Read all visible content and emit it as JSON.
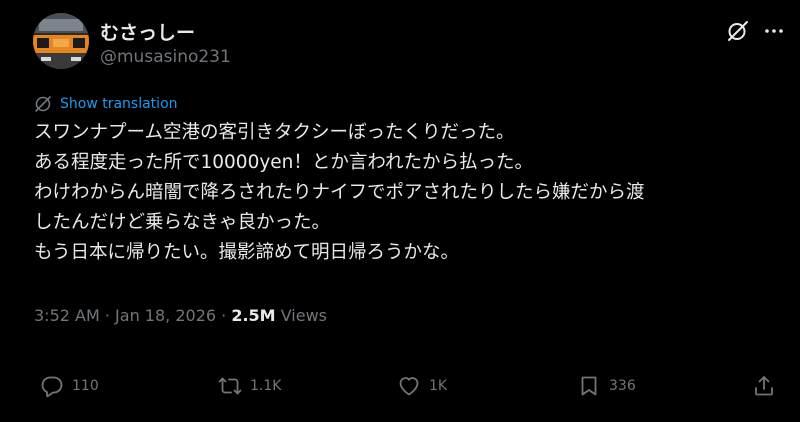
{
  "author": {
    "display_name": "むさっしー",
    "handle": "@musasino231",
    "avatar_icon": "train-avatar"
  },
  "header_icons": [
    "grok-icon",
    "more-icon"
  ],
  "translation": {
    "label": "Show translation",
    "icon": "globe-slash-icon"
  },
  "post": {
    "lines": [
      "スワンナプーム空港の客引きタクシーぼったくりだった。",
      "ある程度走った所で10000yen！とか言われたから払った。",
      "わけわからん暗闇で降ろされたりナイフでポアされたりしたら嫌だから渡",
      "したんだけど乗らなきゃ良かった。",
      "もう日本に帰りたい。撮影諦めて明日帰ろうかな。"
    ]
  },
  "meta": {
    "time": "3:52 AM",
    "separator": "·",
    "date": "Jan 18, 2026",
    "views_count": "2.5M",
    "views_label": "Views"
  },
  "actions": {
    "replies": "110",
    "reposts": "1.1K",
    "likes": "1K",
    "bookmarks": "336"
  },
  "colors": {
    "background": "#000000",
    "text": "#e7e9ea",
    "secondary": "#71767b",
    "link": "#1d9bf0"
  }
}
